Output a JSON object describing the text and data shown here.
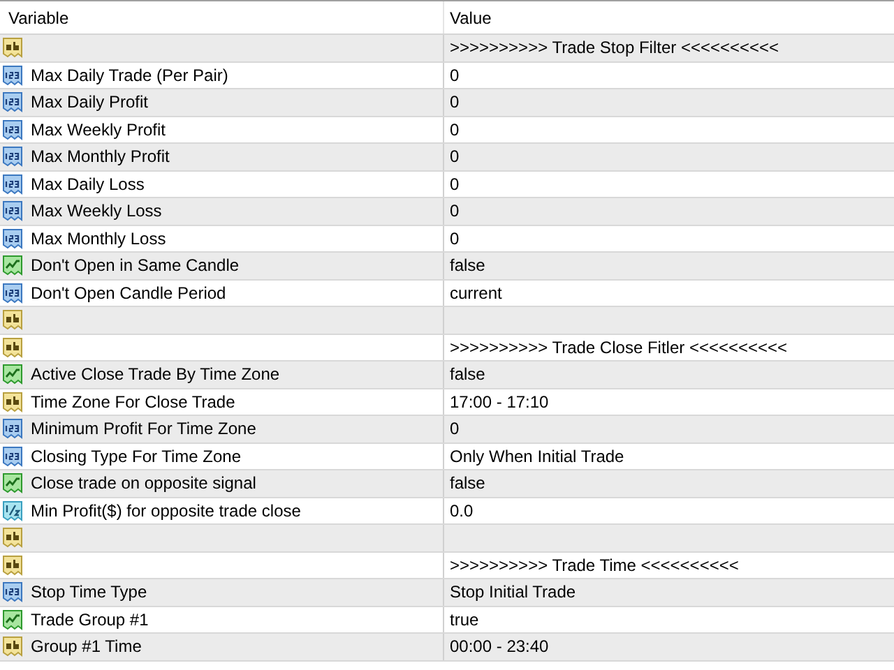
{
  "table": {
    "columns": [
      "Variable",
      "Value"
    ],
    "rows": [
      {
        "kind": "string",
        "variable": "",
        "value": ">>>>>>>>>> Trade Stop Filter <<<<<<<<<<"
      },
      {
        "kind": "int",
        "variable": "Max Daily Trade (Per Pair)",
        "value": "0"
      },
      {
        "kind": "int",
        "variable": "Max Daily Profit",
        "value": "0"
      },
      {
        "kind": "int",
        "variable": "Max Weekly Profit",
        "value": "0"
      },
      {
        "kind": "int",
        "variable": "Max Monthly Profit",
        "value": "0"
      },
      {
        "kind": "int",
        "variable": "Max Daily Loss",
        "value": "0"
      },
      {
        "kind": "int",
        "variable": "Max Weekly Loss",
        "value": "0"
      },
      {
        "kind": "int",
        "variable": "Max Monthly Loss",
        "value": "0"
      },
      {
        "kind": "bool",
        "variable": "Don't Open in Same Candle",
        "value": "false"
      },
      {
        "kind": "int",
        "variable": "Don't Open Candle Period",
        "value": "current"
      },
      {
        "kind": "string",
        "variable": "",
        "value": ""
      },
      {
        "kind": "string",
        "variable": "",
        "value": ">>>>>>>>>> Trade Close Fitler <<<<<<<<<<"
      },
      {
        "kind": "bool",
        "variable": "Active Close Trade By Time Zone",
        "value": "false"
      },
      {
        "kind": "string",
        "variable": "Time Zone For Close Trade",
        "value": "17:00 - 17:10"
      },
      {
        "kind": "int",
        "variable": "Minimum Profit For Time Zone",
        "value": "0"
      },
      {
        "kind": "int",
        "variable": "Closing Type For Time Zone",
        "value": "Only When Initial Trade"
      },
      {
        "kind": "bool",
        "variable": "Close trade on opposite signal",
        "value": "false"
      },
      {
        "kind": "double",
        "variable": "Min Profit($) for opposite trade close",
        "value": "0.0"
      },
      {
        "kind": "string",
        "variable": "",
        "value": ""
      },
      {
        "kind": "string",
        "variable": "",
        "value": ">>>>>>>>>> Trade Time <<<<<<<<<<"
      },
      {
        "kind": "int",
        "variable": "Stop Time Type",
        "value": "Stop Initial Trade"
      },
      {
        "kind": "bool",
        "variable": "Trade Group #1",
        "value": "true"
      },
      {
        "kind": "string",
        "variable": "Group #1 Time",
        "value": "00:00 - 23:40"
      }
    ]
  }
}
